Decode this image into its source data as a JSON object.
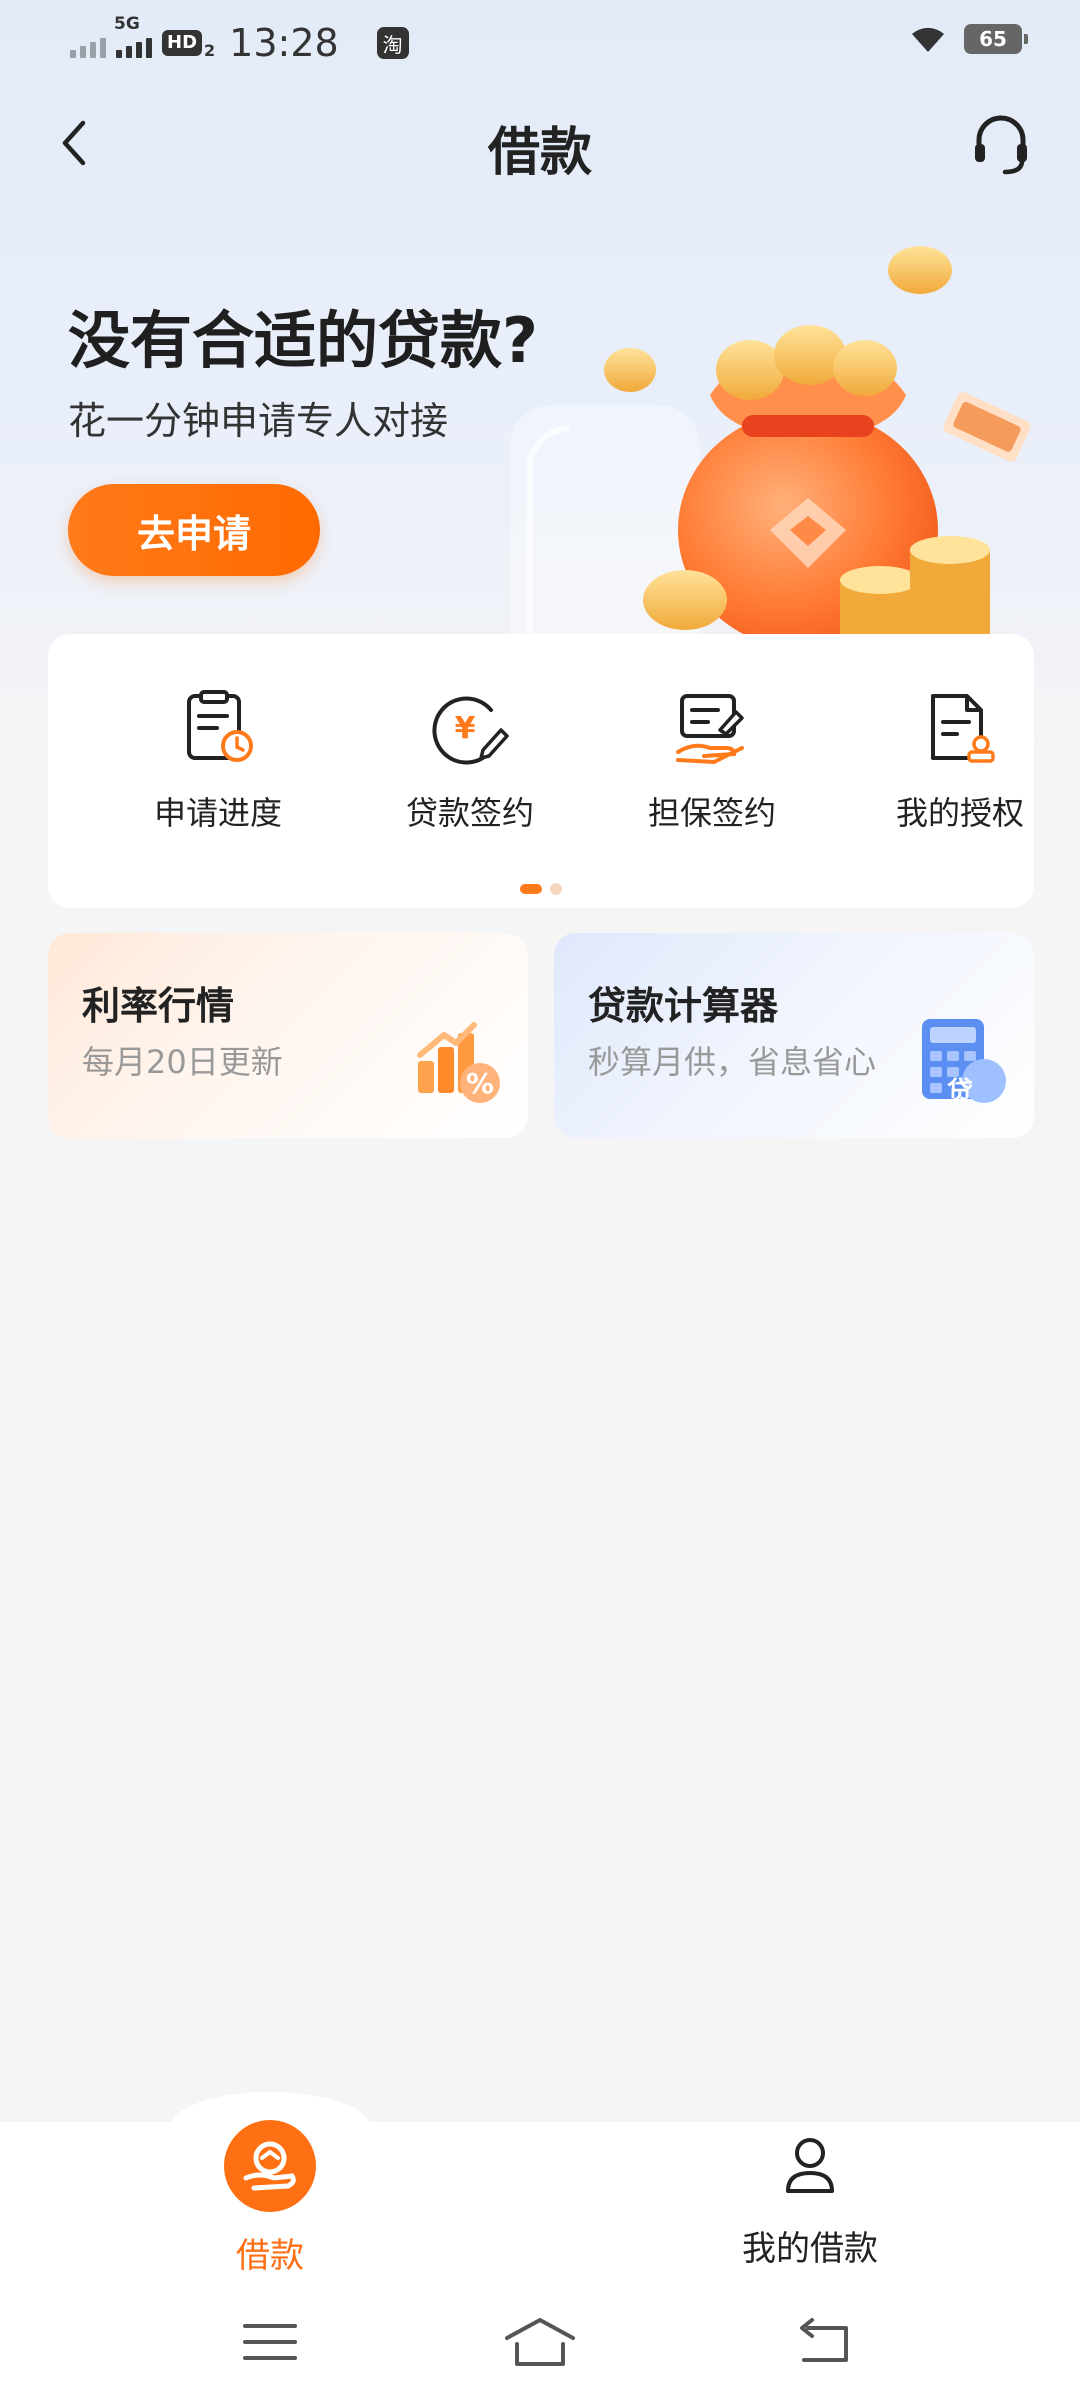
{
  "status_bar": {
    "network_tag": "5G",
    "hd_label": "HD",
    "hd_sub": "2",
    "time": "13:28",
    "app_badge": "淘",
    "battery": "65"
  },
  "header": {
    "title": "借款"
  },
  "hero": {
    "heading": "没有合适的贷款?",
    "subheading": "花一分钟申请专人对接",
    "button_label": "去申请"
  },
  "quick_actions": {
    "items": [
      {
        "label": "申请进度",
        "icon": "application-progress-icon"
      },
      {
        "label": "贷款签约",
        "icon": "loan-signing-icon"
      },
      {
        "label": "担保签约",
        "icon": "guarantee-signing-icon"
      },
      {
        "label": "我的授权",
        "icon": "my-authorization-icon"
      }
    ],
    "page_count": 2,
    "current_page": 1
  },
  "features": {
    "rate": {
      "title": "利率行情",
      "subtitle": "每月20日更新"
    },
    "calculator": {
      "title": "贷款计算器",
      "subtitle": "秒算月供，省息省心",
      "badge": "贷"
    }
  },
  "bottom_nav": {
    "items": [
      {
        "label": "借款",
        "active": true
      },
      {
        "label": "我的借款",
        "active": false
      }
    ]
  },
  "colors": {
    "accent": "#ff7014",
    "background": "#f5f5f5",
    "hero_bg": "#e6edf9"
  }
}
